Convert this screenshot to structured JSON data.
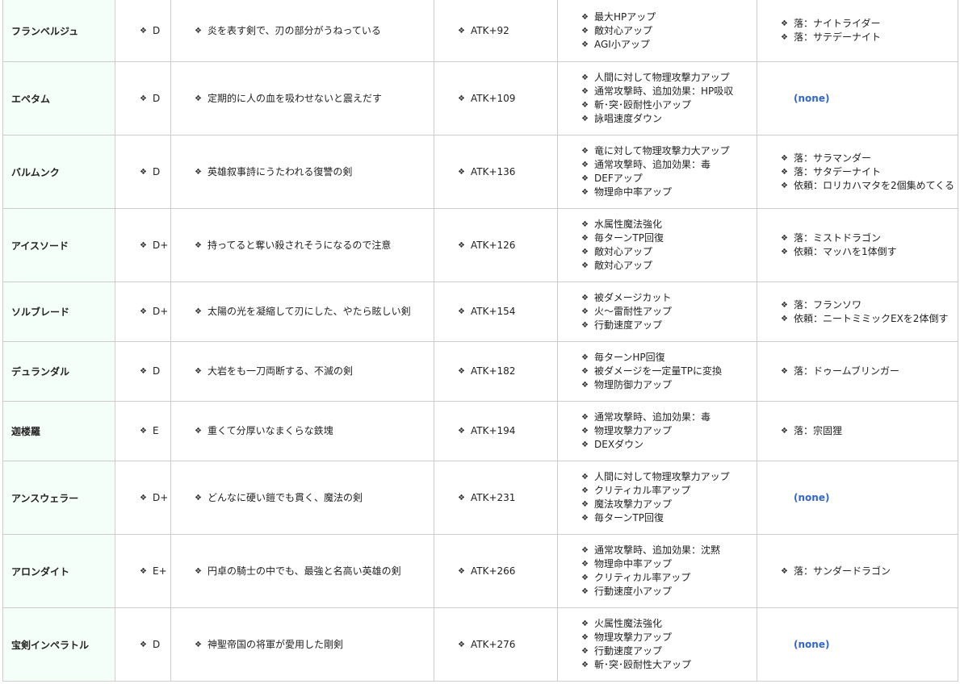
{
  "rows": [
    {
      "name": "フランベルジュ",
      "rank": "D",
      "desc": "炎を表す剣で、刃の部分がうねっている",
      "atk": "ATK+92",
      "effects": [
        "最大HPアップ",
        "敵対心アップ",
        "AGI小アップ"
      ],
      "sources": [
        "落：ナイトライダー",
        "落：サテデーナイト"
      ]
    },
    {
      "name": "エペタム",
      "rank": "D",
      "desc": "定期的に人の血を吸わせないと震えだす",
      "atk": "ATK+109",
      "effects": [
        "人間に対して物理攻撃力アップ",
        "通常攻撃時、追加効果：HP吸収",
        "斬･突･殴耐性小アップ",
        "詠唱速度ダウン"
      ],
      "sources": []
    },
    {
      "name": "バルムンク",
      "rank": "D",
      "desc": "英雄叙事詩にうたわれる復讐の剣",
      "atk": "ATK+136",
      "effects": [
        "竜に対して物理攻撃力大アップ",
        "通常攻撃時、追加効果：毒",
        "DEFアップ",
        "物理命中率アップ"
      ],
      "sources": [
        "落：サラマンダー",
        "落：サタデーナイト",
        "依頼：ロリカハマタを2個集めてくる"
      ]
    },
    {
      "name": "アイスソード",
      "rank": "D+",
      "desc": "持ってると奪い殺されそうになるので注意",
      "atk": "ATK+126",
      "effects": [
        "水属性魔法強化",
        "毎ターンTP回復",
        "敵対心アップ",
        "敵対心アップ"
      ],
      "sources": [
        "落：ミストドラゴン",
        "依頼：マッハを1体倒す"
      ]
    },
    {
      "name": "ソルブレード",
      "rank": "D+",
      "desc": "太陽の光を凝縮して刃にした、やたら眩しい剣",
      "atk": "ATK+154",
      "effects": [
        "被ダメージカット",
        "火～雷耐性アップ",
        "行動速度アップ"
      ],
      "sources": [
        "落：フランソワ",
        "依頼：ニートミミックEXを2体倒す"
      ]
    },
    {
      "name": "デュランダル",
      "rank": "D",
      "desc": "大岩をも一刀両断する、不滅の剣",
      "atk": "ATK+182",
      "effects": [
        "毎ターンHP回復",
        "被ダメージを一定量TPに変換",
        "物理防御力アップ"
      ],
      "sources": [
        "落：ドゥームブリンガー"
      ]
    },
    {
      "name": "迦楼羅",
      "rank": "E",
      "desc": "重くて分厚いなまくらな鉄塊",
      "atk": "ATK+194",
      "effects": [
        "通常攻撃時、追加効果：毒",
        "物理攻撃力アップ",
        "DEXダウン"
      ],
      "sources": [
        "落：宗固狸"
      ]
    },
    {
      "name": "アンスウェラー",
      "rank": "D+",
      "desc": "どんなに硬い鎧でも貫く、魔法の剣",
      "atk": "ATK+231",
      "effects": [
        "人間に対して物理攻撃力アップ",
        "クリティカル率アップ",
        "魔法攻撃力アップ",
        "毎ターンTP回復"
      ],
      "sources": []
    },
    {
      "name": "アロンダイト",
      "rank": "E+",
      "desc": "円卓の騎士の中でも、最強と名高い英雄の剣",
      "atk": "ATK+266",
      "effects": [
        "通常攻撃時、追加効果：沈黙",
        "物理命中率アップ",
        "クリティカル率アップ",
        "行動速度小アップ"
      ],
      "sources": [
        "落：サンダードラゴン"
      ]
    },
    {
      "name": "宝剣インペラトル",
      "rank": "D",
      "desc": "神聖帝国の将軍が愛用した剛剣",
      "atk": "ATK+276",
      "effects": [
        "火属性魔法強化",
        "物理攻撃力アップ",
        "行動速度アップ",
        "斬･突･殴耐性大アップ"
      ],
      "sources": []
    }
  ],
  "none_label": "(none)",
  "colors": {
    "name_bg": "#f5fffa",
    "border": "#cccccc",
    "none_link": "#3366cc"
  }
}
